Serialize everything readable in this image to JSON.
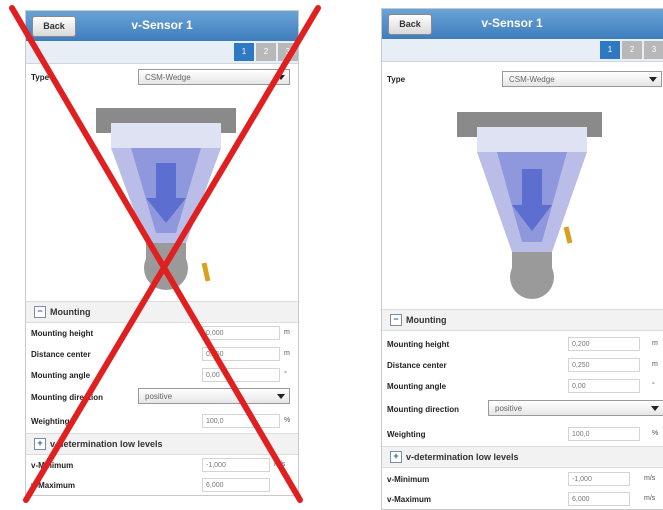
{
  "left": {
    "back_label": "Back",
    "title": "v-Sensor 1",
    "pages": [
      "1",
      "2",
      "3"
    ],
    "type_label": "Type",
    "type_value": "CSM-Wedge",
    "mounting_section": "Mounting",
    "mounting_height_label": "Mounting height",
    "mounting_height_value": "0,000",
    "mounting_height_unit": "m",
    "distance_center_label": "Distance center",
    "distance_center_value": "0,250",
    "distance_center_unit": "m",
    "mounting_angle_label": "Mounting angle",
    "mounting_angle_value": "0,00",
    "mounting_angle_unit": "°",
    "mounting_direction_label": "Mounting direction",
    "mounting_direction_value": "positive",
    "weighting_label": "Weighting",
    "weighting_value": "100,0",
    "weighting_unit": "%",
    "v_section": "v-determination low levels",
    "v_min_label": "v-Minimum",
    "v_min_value": "-1,000",
    "v_min_unit": "m/s",
    "v_max_label": "v-Maximum",
    "v_max_value": "6,000"
  },
  "right": {
    "back_label": "Back",
    "title": "v-Sensor 1",
    "pages": [
      "1",
      "2",
      "3"
    ],
    "type_label": "Type",
    "type_value": "CSM-Wedge",
    "mounting_section": "Mounting",
    "mounting_height_label": "Mounting height",
    "mounting_height_value": "0,200",
    "mounting_height_unit": "m",
    "distance_center_label": "Distance center",
    "distance_center_value": "0,250",
    "distance_center_unit": "m",
    "mounting_angle_label": "Mounting angle",
    "mounting_angle_value": "0,00",
    "mounting_angle_unit": "°",
    "mounting_direction_label": "Mounting direction",
    "mounting_direction_value": "positive",
    "weighting_label": "Weighting",
    "weighting_value": "100,0",
    "weighting_unit": "%",
    "v_section": "v-determination low levels",
    "v_min_label": "v-Minimum",
    "v_min_value": "-1,000",
    "v_min_unit": "m/s",
    "v_max_label": "v-Maximum",
    "v_max_value": "6,000",
    "v_max_unit": "m/s"
  },
  "colors": {
    "title_bar": "#3e7dbd",
    "active_page": "#2f78c4",
    "cross": "#e02020"
  },
  "icons": [
    "chevron-down-icon",
    "collapse-minus-icon",
    "expand-plus-icon",
    "channel-diagram"
  ]
}
